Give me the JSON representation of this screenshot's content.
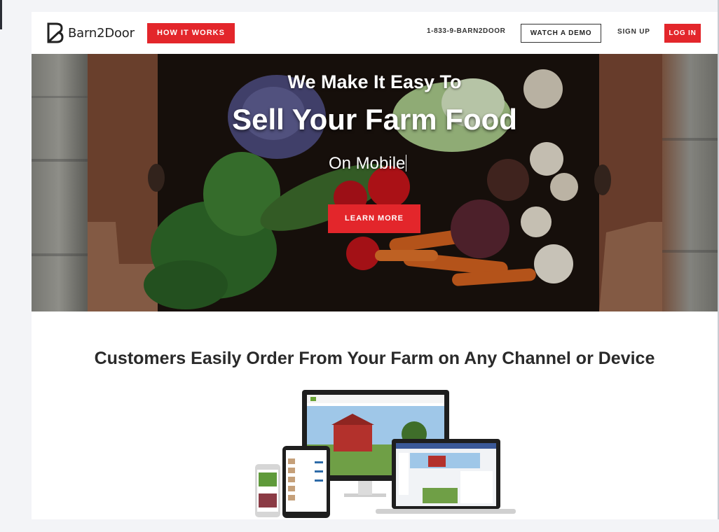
{
  "header": {
    "logo_text": "Barn2Door",
    "how_it_works": "HOW IT WORKS",
    "phone": "1-833-9-BARN2DOOR",
    "watch_demo": "WATCH A DEMO",
    "sign_up": "SIGN UP",
    "log_in": "LOG IN"
  },
  "hero": {
    "line1": "We Make It Easy To",
    "line2": "Sell Your Farm Food",
    "line3": "On Mobile",
    "cta": "LEARN MORE"
  },
  "section": {
    "title": "Customers Easily Order From Your Farm on Any Channel or Device"
  },
  "colors": {
    "accent": "#e3262b",
    "text_dark": "#2a2a2a"
  },
  "icons": [
    "barn2door-logo-icon"
  ]
}
